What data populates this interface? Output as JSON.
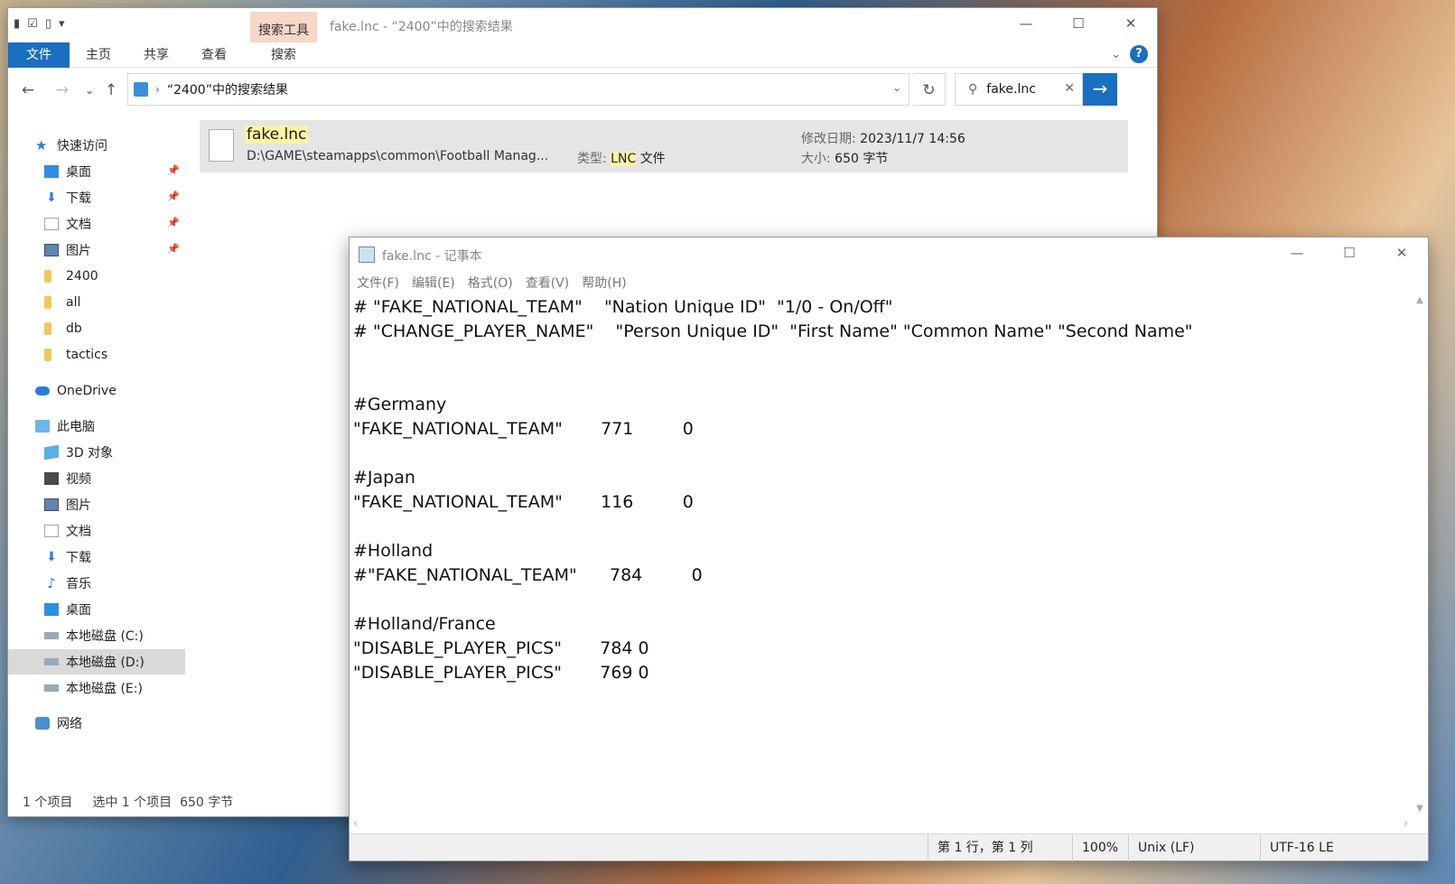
{
  "explorer": {
    "title": "fake.lnc - “2400”中的搜索结果",
    "context_tab": "搜索工具",
    "tabs": [
      "文件",
      "主页",
      "共享",
      "查看",
      "搜索"
    ],
    "address_text": "“2400”中的搜索结果",
    "search_value": "fake.lnc",
    "sidebar": [
      {
        "label": "快速访问",
        "icon": "star-icon"
      },
      {
        "label": "桌面",
        "icon": "desktop-icon",
        "pinned": true
      },
      {
        "label": "下载",
        "icon": "download-icon",
        "pinned": true
      },
      {
        "label": "文档",
        "icon": "document-icon",
        "pinned": true
      },
      {
        "label": "图片",
        "icon": "picture-icon",
        "pinned": true
      },
      {
        "label": "2400",
        "icon": "folder-icon"
      },
      {
        "label": "all",
        "icon": "folder-icon"
      },
      {
        "label": "db",
        "icon": "folder-icon"
      },
      {
        "label": "tactics",
        "icon": "folder-icon"
      },
      {
        "label": "OneDrive",
        "icon": "cloud-icon"
      },
      {
        "label": "此电脑",
        "icon": "pc-icon"
      },
      {
        "label": "3D 对象",
        "icon": "cube-icon"
      },
      {
        "label": "视频",
        "icon": "video-icon"
      },
      {
        "label": "图片",
        "icon": "picture-icon"
      },
      {
        "label": "文档",
        "icon": "document-icon"
      },
      {
        "label": "下载",
        "icon": "download-icon"
      },
      {
        "label": "音乐",
        "icon": "music-icon"
      },
      {
        "label": "桌面",
        "icon": "desktop-icon"
      },
      {
        "label": "本地磁盘 (C:)",
        "icon": "drive-icon"
      },
      {
        "label": "本地磁盘 (D:)",
        "icon": "drive-icon",
        "selected": true
      },
      {
        "label": "本地磁盘 (E:)",
        "icon": "drive-icon"
      },
      {
        "label": "网络",
        "icon": "network-icon"
      }
    ],
    "result": {
      "name": "fake.lnc",
      "path": "D:\\GAME\\steamapps\\common\\Football Manag...",
      "type_label": "类型:",
      "type_highlight": "LNC",
      "type_suffix": "文件",
      "modified_label": "修改日期:",
      "modified_value": "2023/11/7 14:56",
      "size_label": "大小:",
      "size_value": "650 字节"
    },
    "status": {
      "count": "1 个项目",
      "selected": "选中 1 个项目",
      "size": "650 字节"
    }
  },
  "notepad": {
    "title": "fake.lnc - 记事本",
    "menu": [
      "文件(F)",
      "编辑(E)",
      "格式(O)",
      "查看(V)",
      "帮助(H)"
    ],
    "content": "# \"FAKE_NATIONAL_TEAM\"    \"Nation Unique ID\"  \"1/0 - On/Off\"\n# \"CHANGE_PLAYER_NAME\"    \"Person Unique ID\"  \"First Name\" \"Common Name\" \"Second Name\"\n\n\n#Germany\n\"FAKE_NATIONAL_TEAM\"       771         0\n\n#Japan\n\"FAKE_NATIONAL_TEAM\"       116         0\n\n#Holland\n#\"FAKE_NATIONAL_TEAM\"      784         0\n\n#Holland/France\n\"DISABLE_PLAYER_PICS\"       784 0\n\"DISABLE_PLAYER_PICS\"       769 0",
    "status": {
      "position": "第 1 行，第 1 列",
      "zoom": "100%",
      "line_ending": "Unix (LF)",
      "encoding": "UTF-16 LE"
    }
  }
}
